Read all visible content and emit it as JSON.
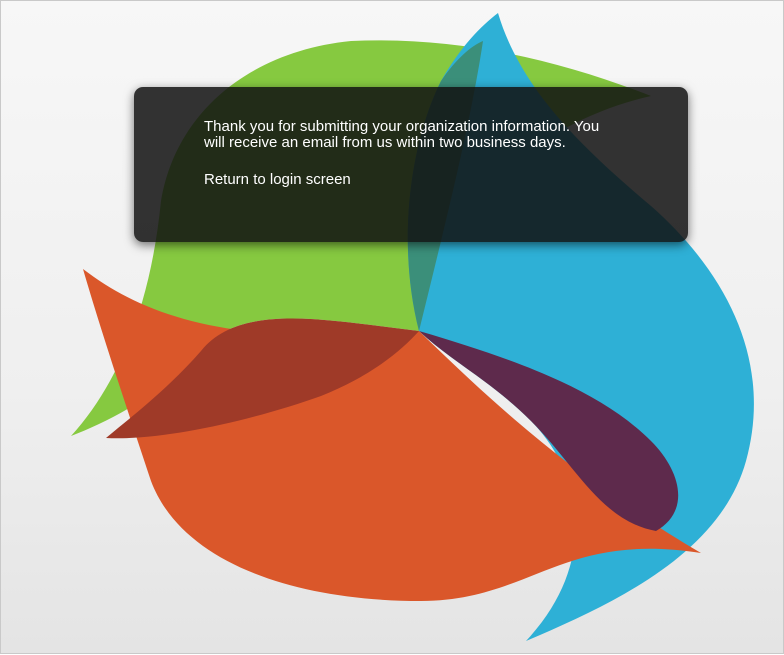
{
  "dialog": {
    "message": "Thank you for submitting your organization information.  You will receive an email from us within two business days.",
    "return_link": "Return to login screen"
  },
  "logo": {
    "icon": "pinwheel-logo",
    "colors": {
      "green": "#86c940",
      "blue": "#2eb0d6",
      "orange": "#da572a",
      "purple": "#5e2a4c"
    }
  }
}
